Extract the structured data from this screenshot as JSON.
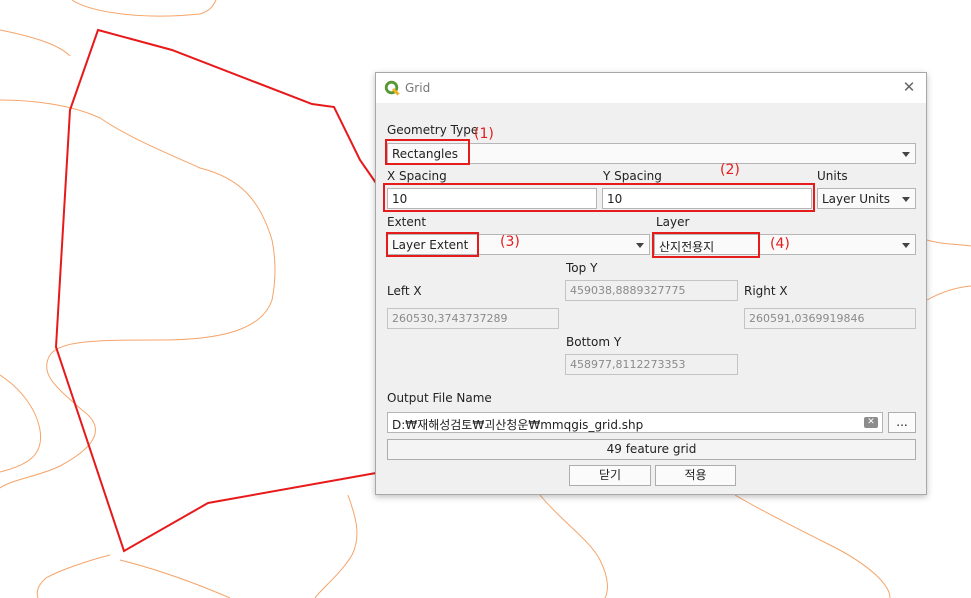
{
  "dialog": {
    "title": "Grid",
    "close_symbol": "✕",
    "geometry_type_label": "Geometry Type",
    "geometry_type_value": "Rectangles",
    "x_spacing_label": "X Spacing",
    "x_spacing_value": "10",
    "y_spacing_label": "Y Spacing",
    "y_spacing_value": "10",
    "units_label": "Units",
    "units_value": "Layer Units",
    "extent_label": "Extent",
    "extent_value": "Layer Extent",
    "layer_label": "Layer",
    "layer_value": "산지전용지",
    "top_y_label": "Top Y",
    "top_y_value": "459038,8889327775",
    "left_x_label": "Left X",
    "left_x_value": "260530,3743737289",
    "right_x_label": "Right X",
    "right_x_value": "260591,0369919846",
    "bottom_y_label": "Bottom Y",
    "bottom_y_value": "458977,8112273353",
    "output_label": "Output File Name",
    "output_value": "D:₩재해성검토₩괴산청운₩mmqgis_grid.shp",
    "browse_label": "...",
    "status": "49 feature grid",
    "close_button": "닫기",
    "apply_button": "적용"
  },
  "annotations": [
    "(1)",
    "(2)",
    "(3)",
    "(4)"
  ],
  "colors": {
    "annotation_red": "#e41c1c",
    "map_polygon": "#e8191a",
    "map_lines": "#f5a46a",
    "qgis_green": "#589632"
  }
}
